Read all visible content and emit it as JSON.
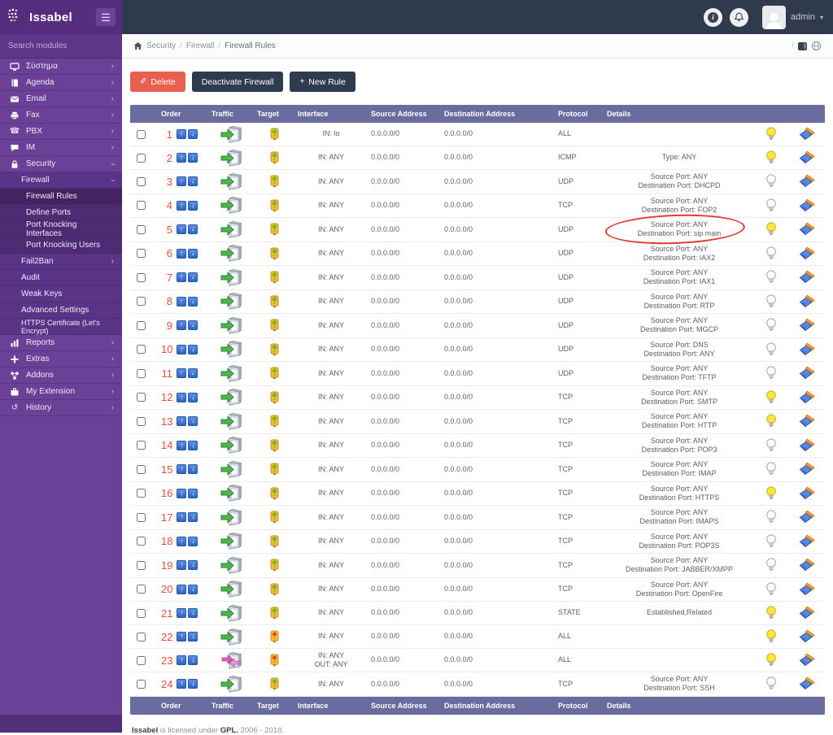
{
  "brand": {
    "name": "Issabel"
  },
  "topbar": {
    "user": "admin",
    "icons": [
      "info-icon",
      "bell-icon",
      "avatar"
    ]
  },
  "sidebar": {
    "search_placeholder": "Search modules",
    "top": [
      "Σύστημα",
      "Agenda",
      "Email",
      "Fax",
      "PBX",
      "IM",
      "Security",
      "Reports",
      "Extras",
      "Addons",
      "My Extension",
      "History"
    ],
    "icons": [
      "monitor",
      "book",
      "envelope",
      "fax",
      "phone",
      "chat",
      "lock",
      "bar-chart",
      "plus",
      "addons",
      "briefcase",
      "history"
    ],
    "firewall": "Firewall",
    "firewall_items": [
      "Firewall Rules",
      "Define Ports",
      "Port Knocking Interfaces",
      "Port Knocking Users"
    ],
    "security_items": [
      "Fail2Ban",
      "Audit",
      "Weak Keys",
      "Advanced Settings",
      "HTTPS Certificate (Let's Encrypt)"
    ],
    "active_item": "Firewall Rules"
  },
  "breadcrumb": {
    "items": [
      "Security",
      "Firewall",
      "Firewall Rules"
    ],
    "right_sep": "/"
  },
  "toolbar": {
    "delete_label": "Delete",
    "deactivate_label": "Deactivate Firewall",
    "new_rule_label": "New Rule",
    "new_rule_plus": "+"
  },
  "table": {
    "columns": [
      "Order",
      "Traffic",
      "Target",
      "Interface",
      "Source Address",
      "Destination Address",
      "Protocol",
      "Details"
    ],
    "rows": [
      {
        "order": "1",
        "traffic": "input",
        "target": "accept",
        "interface": [
          "IN: lo"
        ],
        "source": "0.0.0.0/0",
        "destination": "0.0.0.0/0",
        "protocol": "ALL",
        "details": [],
        "enabled": true,
        "annotated": false
      },
      {
        "order": "2",
        "traffic": "input",
        "target": "accept",
        "interface": [
          "IN: ANY"
        ],
        "source": "0.0.0.0/0",
        "destination": "0.0.0.0/0",
        "protocol": "ICMP",
        "details": [
          "Type: ANY"
        ],
        "enabled": true,
        "annotated": false
      },
      {
        "order": "3",
        "traffic": "input",
        "target": "accept",
        "interface": [
          "IN: ANY"
        ],
        "source": "0.0.0.0/0",
        "destination": "0.0.0.0/0",
        "protocol": "UDP",
        "details": [
          "Source Port: ANY",
          "Destination Port: DHCPD"
        ],
        "enabled": false,
        "annotated": false
      },
      {
        "order": "4",
        "traffic": "input",
        "target": "accept",
        "interface": [
          "IN: ANY"
        ],
        "source": "0.0.0.0/0",
        "destination": "0.0.0.0/0",
        "protocol": "TCP",
        "details": [
          "Source Port: ANY",
          "Destination Port: FOP2"
        ],
        "enabled": false,
        "annotated": false
      },
      {
        "order": "5",
        "traffic": "input",
        "target": "accept",
        "interface": [
          "IN: ANY"
        ],
        "source": "0.0.0.0/0",
        "destination": "0.0.0.0/0",
        "protocol": "UDP",
        "details": [
          "Source Port: ANY",
          "Destination Port: sip main"
        ],
        "enabled": true,
        "annotated": true
      },
      {
        "order": "6",
        "traffic": "input",
        "target": "accept",
        "interface": [
          "IN: ANY"
        ],
        "source": "0.0.0.0/0",
        "destination": "0.0.0.0/0",
        "protocol": "UDP",
        "details": [
          "Source Port: ANY",
          "Destination Port: IAX2"
        ],
        "enabled": false,
        "annotated": false
      },
      {
        "order": "7",
        "traffic": "input",
        "target": "accept",
        "interface": [
          "IN: ANY"
        ],
        "source": "0.0.0.0/0",
        "destination": "0.0.0.0/0",
        "protocol": "UDP",
        "details": [
          "Source Port: ANY",
          "Destination Port: IAX1"
        ],
        "enabled": false,
        "annotated": false
      },
      {
        "order": "8",
        "traffic": "input",
        "target": "accept",
        "interface": [
          "IN: ANY"
        ],
        "source": "0.0.0.0/0",
        "destination": "0.0.0.0/0",
        "protocol": "UDP",
        "details": [
          "Source Port: ANY",
          "Destination Port: RTP"
        ],
        "enabled": false,
        "annotated": false
      },
      {
        "order": "9",
        "traffic": "input",
        "target": "accept",
        "interface": [
          "IN: ANY"
        ],
        "source": "0.0.0.0/0",
        "destination": "0.0.0.0/0",
        "protocol": "UDP",
        "details": [
          "Source Port: ANY",
          "Destination Port: MGCP"
        ],
        "enabled": false,
        "annotated": false
      },
      {
        "order": "10",
        "traffic": "input",
        "target": "accept",
        "interface": [
          "IN: ANY"
        ],
        "source": "0.0.0.0/0",
        "destination": "0.0.0.0/0",
        "protocol": "UDP",
        "details": [
          "Source Port: DNS",
          "Destination Port: ANY"
        ],
        "enabled": false,
        "annotated": false
      },
      {
        "order": "11",
        "traffic": "input",
        "target": "accept",
        "interface": [
          "IN: ANY"
        ],
        "source": "0.0.0.0/0",
        "destination": "0.0.0.0/0",
        "protocol": "UDP",
        "details": [
          "Source Port: ANY",
          "Destination Port: TFTP"
        ],
        "enabled": false,
        "annotated": false
      },
      {
        "order": "12",
        "traffic": "input",
        "target": "accept",
        "interface": [
          "IN: ANY"
        ],
        "source": "0.0.0.0/0",
        "destination": "0.0.0.0/0",
        "protocol": "TCP",
        "details": [
          "Source Port: ANY",
          "Destination Port: SMTP"
        ],
        "enabled": true,
        "annotated": false
      },
      {
        "order": "13",
        "traffic": "input",
        "target": "accept",
        "interface": [
          "IN: ANY"
        ],
        "source": "0.0.0.0/0",
        "destination": "0.0.0.0/0",
        "protocol": "TCP",
        "details": [
          "Source Port: ANY",
          "Destination Port: HTTP"
        ],
        "enabled": true,
        "annotated": false
      },
      {
        "order": "14",
        "traffic": "input",
        "target": "accept",
        "interface": [
          "IN: ANY"
        ],
        "source": "0.0.0.0/0",
        "destination": "0.0.0.0/0",
        "protocol": "TCP",
        "details": [
          "Source Port: ANY",
          "Destination Port: POP3"
        ],
        "enabled": false,
        "annotated": false
      },
      {
        "order": "15",
        "traffic": "input",
        "target": "accept",
        "interface": [
          "IN: ANY"
        ],
        "source": "0.0.0.0/0",
        "destination": "0.0.0.0/0",
        "protocol": "TCP",
        "details": [
          "Source Port: ANY",
          "Destination Port: IMAP"
        ],
        "enabled": false,
        "annotated": false
      },
      {
        "order": "16",
        "traffic": "input",
        "target": "accept",
        "interface": [
          "IN: ANY"
        ],
        "source": "0.0.0.0/0",
        "destination": "0.0.0.0/0",
        "protocol": "TCP",
        "details": [
          "Source Port: ANY",
          "Destination Port: HTTPS"
        ],
        "enabled": true,
        "annotated": false
      },
      {
        "order": "17",
        "traffic": "input",
        "target": "accept",
        "interface": [
          "IN: ANY"
        ],
        "source": "0.0.0.0/0",
        "destination": "0.0.0.0/0",
        "protocol": "TCP",
        "details": [
          "Source Port: ANY",
          "Destination Port: IMAPS"
        ],
        "enabled": false,
        "annotated": false
      },
      {
        "order": "18",
        "traffic": "input",
        "target": "accept",
        "interface": [
          "IN: ANY"
        ],
        "source": "0.0.0.0/0",
        "destination": "0.0.0.0/0",
        "protocol": "TCP",
        "details": [
          "Source Port: ANY",
          "Destination Port: POP3S"
        ],
        "enabled": false,
        "annotated": false
      },
      {
        "order": "19",
        "traffic": "input",
        "target": "accept",
        "interface": [
          "IN: ANY"
        ],
        "source": "0.0.0.0/0",
        "destination": "0.0.0.0/0",
        "protocol": "TCP",
        "details": [
          "Source Port: ANY",
          "Destination Port: JABBER/XMPP"
        ],
        "enabled": false,
        "annotated": false
      },
      {
        "order": "20",
        "traffic": "input",
        "target": "accept",
        "interface": [
          "IN: ANY"
        ],
        "source": "0.0.0.0/0",
        "destination": "0.0.0.0/0",
        "protocol": "TCP",
        "details": [
          "Source Port: ANY",
          "Destination Port: OpenFire"
        ],
        "enabled": false,
        "annotated": false
      },
      {
        "order": "21",
        "traffic": "input",
        "target": "accept",
        "interface": [
          "IN: ANY"
        ],
        "source": "0.0.0.0/0",
        "destination": "0.0.0.0/0",
        "protocol": "STATE",
        "details": [
          "Established,Related"
        ],
        "enabled": true,
        "annotated": false
      },
      {
        "order": "22",
        "traffic": "input",
        "target": "reject",
        "interface": [
          "IN: ANY"
        ],
        "source": "0.0.0.0/0",
        "destination": "0.0.0.0/0",
        "protocol": "ALL",
        "details": [],
        "enabled": true,
        "annotated": false
      },
      {
        "order": "23",
        "traffic": "forward",
        "target": "reject",
        "interface": [
          "IN: ANY",
          "OUT: ANY"
        ],
        "source": "0.0.0.0/0",
        "destination": "0.0.0.0/0",
        "protocol": "ALL",
        "details": [],
        "enabled": true,
        "annotated": false
      },
      {
        "order": "24",
        "traffic": "input",
        "target": "accept",
        "interface": [
          "IN: ANY"
        ],
        "source": "0.0.0.0/0",
        "destination": "0.0.0.0/0",
        "protocol": "TCP",
        "details": [
          "Source Port: ANY",
          "Destination Port: SSH"
        ],
        "enabled": false,
        "annotated": false
      }
    ]
  },
  "annotation": {
    "type": "ellipse",
    "row_order": "5",
    "color": "#e23b2e"
  },
  "footer": {
    "brand": "Issabel",
    "mid": "is licensed under",
    "gpl": "GPL.",
    "years": "2006 - 2018."
  },
  "colors": {
    "sidebar": "#6a4197",
    "topbar": "#2f3b4c",
    "table_header": "#6a6b9f",
    "delete_btn": "#e8604f",
    "dark_btn": "#2f3b4e",
    "order_number": "#e65037"
  }
}
